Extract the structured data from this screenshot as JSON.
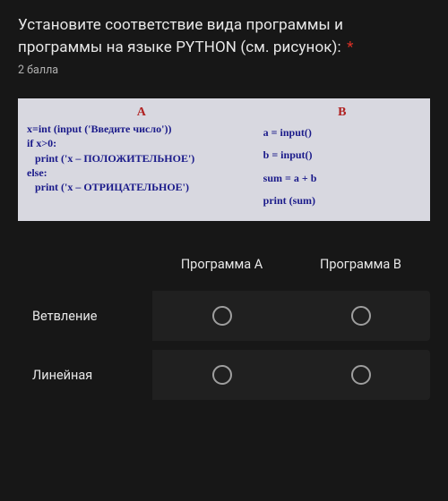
{
  "question": {
    "text": "Установите соответствие вида программы и программы на языке PYTHON (см. рисунок):",
    "required_mark": "*",
    "points": "2 балла"
  },
  "code": {
    "col_a_header": "A",
    "col_b_header": "B",
    "a_lines": [
      "x=int (input ('Введите число'))",
      "if x>0:",
      "   print ('x – ПОЛОЖИТЕЛЬНОЕ')",
      "else:",
      "   print ('x – ОТРИЦАТЕЛЬНОЕ')"
    ],
    "b_lines": [
      "a = input()",
      "b = input()",
      "sum = a + b",
      "print (sum)"
    ]
  },
  "grid": {
    "columns": [
      "Программа A",
      "Программа B"
    ],
    "rows": [
      "Ветвление",
      "Линейная"
    ]
  }
}
